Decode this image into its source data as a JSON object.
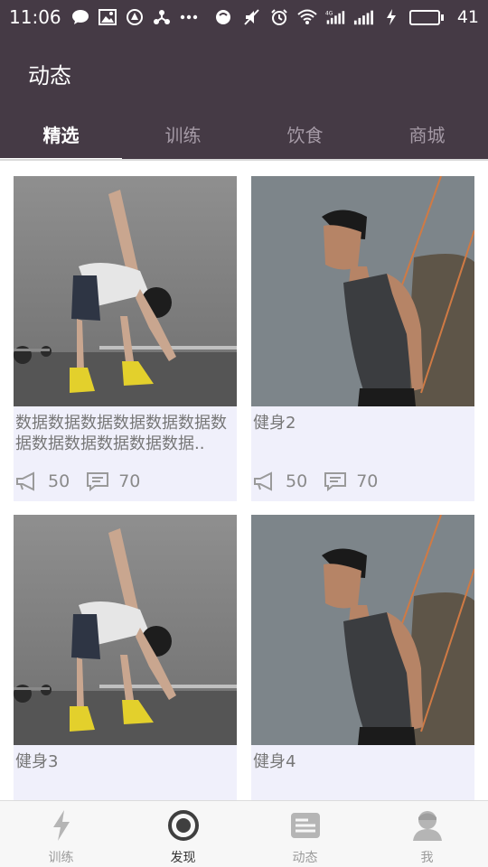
{
  "status_bar": {
    "time": "11:06",
    "battery_level": "41",
    "battery_fraction": 0.41,
    "icons_left": [
      "chat-icon",
      "image-icon",
      "app-icon",
      "share-icon",
      "more-icon"
    ],
    "icons_right": [
      "signal-app-icon",
      "mute-icon",
      "alarm-icon",
      "wifi-icon",
      "4g-signal-icon",
      "signal-icon",
      "charging-icon"
    ]
  },
  "header": {
    "title": "动态",
    "tabs": [
      {
        "label": "精选",
        "active": true
      },
      {
        "label": "训练",
        "active": false
      },
      {
        "label": "饮食",
        "active": false
      },
      {
        "label": "商城",
        "active": false
      }
    ]
  },
  "cards": [
    {
      "caption": "数据数据数据数据数据数据数据数据数据数据数据数据..",
      "likes": "50",
      "comments": "70",
      "image": "stretching-man"
    },
    {
      "caption": "健身2",
      "likes": "50",
      "comments": "70",
      "image": "rope-man"
    },
    {
      "caption": "健身3",
      "likes": "",
      "comments": "",
      "image": "stretching-man"
    },
    {
      "caption": "健身4",
      "likes": "",
      "comments": "",
      "image": "rope-man"
    }
  ],
  "bottom_nav": [
    {
      "label": "训练",
      "icon": "lightning-icon",
      "active": false
    },
    {
      "label": "发现",
      "icon": "target-icon",
      "active": true
    },
    {
      "label": "动态",
      "icon": "feed-icon",
      "active": false
    },
    {
      "label": "我",
      "icon": "profile-icon",
      "active": false
    }
  ],
  "colors": {
    "header_bg": "#453a45",
    "card_bg": "#f0f0fb",
    "tab_inactive": "#a59aa6",
    "battery_green": "#3cd33c"
  }
}
